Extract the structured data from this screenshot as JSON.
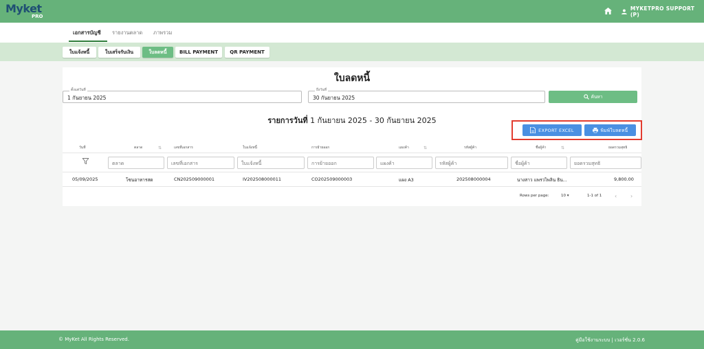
{
  "header": {
    "logo_text": "Myket",
    "logo_sub": "PRO",
    "user_label": "MYKETPRO SUPPORT (P)"
  },
  "nav": {
    "tabs": [
      {
        "label": "เอกสารบัญชี",
        "active": true
      },
      {
        "label": "รายงานตลาด",
        "active": false
      },
      {
        "label": "ภาพรวม",
        "active": false
      }
    ]
  },
  "subnav": {
    "buttons": [
      {
        "label": "ใบแจ้งหนี้",
        "active": false
      },
      {
        "label": "ใบเสร็จรับเงิน",
        "active": false
      },
      {
        "label": "ใบลดหนี้",
        "active": true
      },
      {
        "label": "BILL PAYMENT",
        "active": false
      },
      {
        "label": "QR PAYMENT",
        "active": false
      }
    ]
  },
  "page": {
    "title": "ใบลดหนี้",
    "start_label": "ตั้งแต่วันที่",
    "start_value": "1 กันยายน 2025",
    "end_label": "ถึงวันที่",
    "end_value": "30 กันยายน 2025",
    "search_label": "ค้นหา",
    "report_prefix": "รายการวันที่",
    "report_range": "1 กันยายน 2025 - 30 กันยายน 2025",
    "export_label": "EXPORT EXCEL",
    "print_label": "พิมพ์ใบลดหนี้"
  },
  "table": {
    "headers": [
      "วันที่",
      "ตลาด",
      "เลขที่เอกสาร",
      "ใบแจ้งหนี้",
      "การย้ายออก",
      "แผงค้า",
      "รหัสผู้ค้า",
      "ชื่อผู้ค้า",
      "ยอดรวมสุทธิ"
    ],
    "filters": [
      "ตลาด",
      "เลขที่เอกสาร",
      "ใบแจ้งหนี้",
      "การย้ายออก",
      "แผงค้า",
      "รหัสผู้ค้า",
      "ชื่อผู้ค้า",
      "ยอดรวมสุทธิ"
    ],
    "rows": [
      [
        "05/09/2025",
        "โซนอาหารสด",
        "CN202509000001",
        "IV202508000011",
        "CO202509000003",
        "แผง A3",
        "202508000004",
        "นางสาว แพรวไพลิน ธิน...",
        "9,800.00"
      ]
    ],
    "rows_per_page_label": "Rows per page:",
    "rows_per_page": "10",
    "page_info": "1-1 of 1"
  },
  "footer": {
    "copyright": "© MyKet All Rights Reserved.",
    "right_text": "คู่มือใช้งานระบบ | เวอร์ชั่น 2.0.6"
  },
  "colors": {
    "primary_green": "#66b27a",
    "light_green": "#d3e8d3",
    "accent_blue": "#4a90e2",
    "highlight_red": "#e23b2e"
  }
}
